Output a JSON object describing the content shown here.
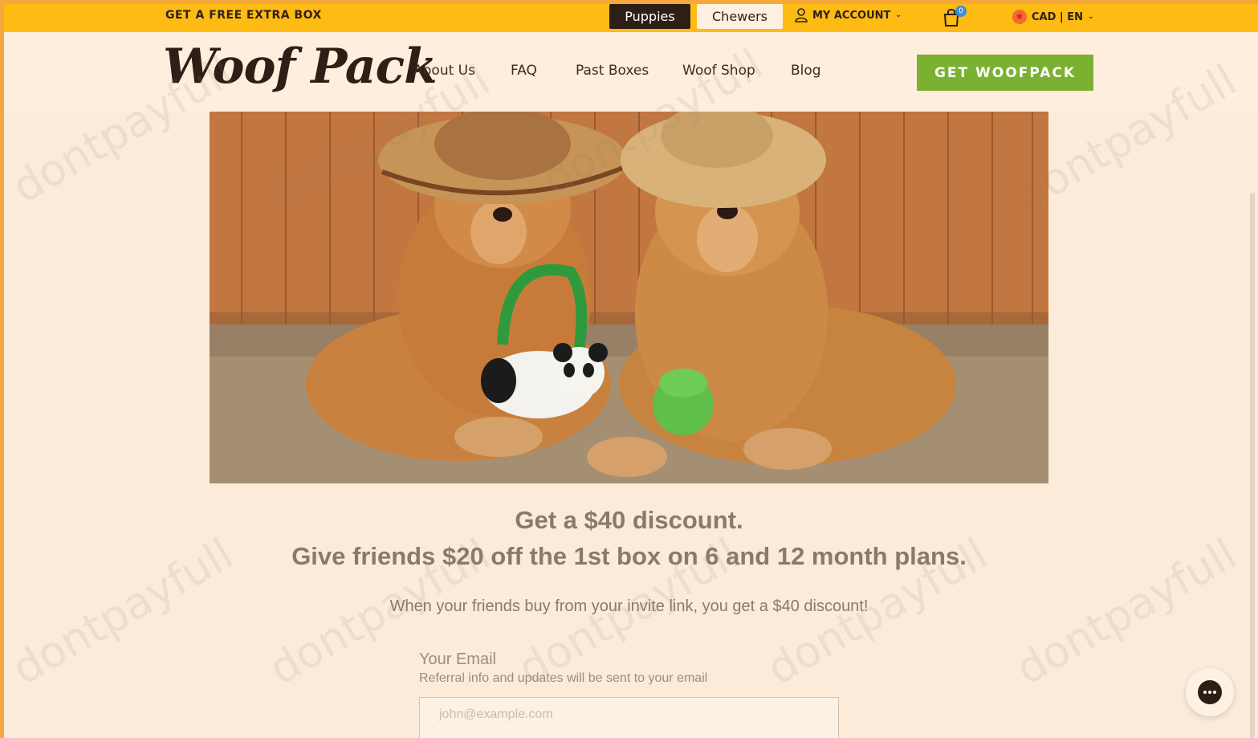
{
  "topbar": {
    "promo": "GET A FREE EXTRA BOX",
    "segments": [
      "Puppies",
      "Chewers"
    ],
    "account_label": "MY ACCOUNT",
    "cart_count": "0",
    "currency_label": "CAD | EN"
  },
  "header": {
    "logo": "Woof Pack",
    "nav": [
      "About Us",
      "FAQ",
      "Past Boxes",
      "Woof Shop",
      "Blog"
    ],
    "cta": "GET WOOFPACK"
  },
  "main": {
    "headline": "Get a $40 discount.",
    "headline2": "Give friends $20 off the 1st box on 6 and 12 month plans.",
    "subtext": "When your friends buy from your invite link, you get a $40 discount!",
    "email": {
      "label": "Your Email",
      "help": "Referral info and updates will be sent to your email",
      "placeholder": "john@example.com",
      "value": ""
    }
  },
  "watermark": "dontpayfull",
  "colors": {
    "announcement_bar": "#fdbb14",
    "page_bg": "#fcebd9",
    "cta_green": "#7ab131",
    "dark_brown": "#2e1f16",
    "text_muted": "#8a7a6d"
  },
  "icons": [
    "user-icon",
    "chevron-down-icon",
    "cart-icon",
    "canada-flag-icon",
    "chat-icon"
  ]
}
